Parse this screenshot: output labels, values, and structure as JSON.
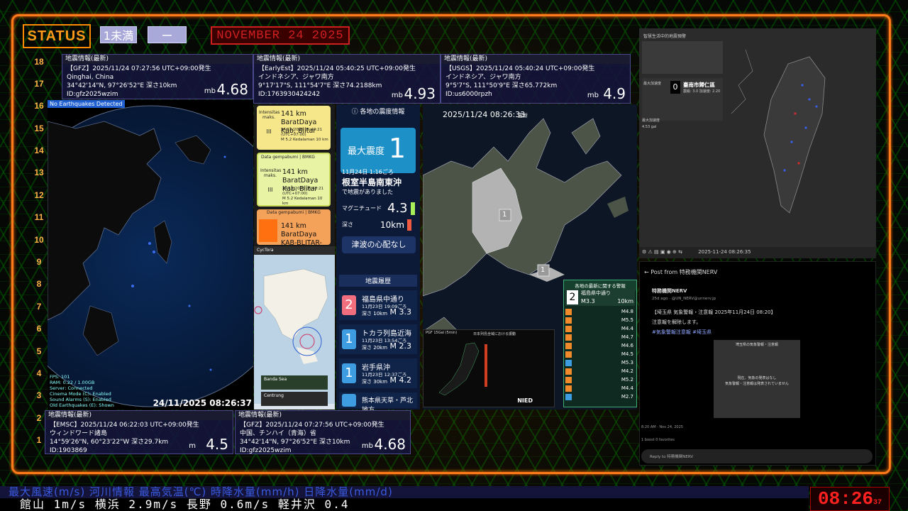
{
  "header": {
    "status_label": "STATUS",
    "chip1": "1未満",
    "chip2": "ー",
    "date": "NOVEMBER 24 2025"
  },
  "scale_numbers": [
    "18",
    "17",
    "16",
    "15",
    "14",
    "13",
    "12",
    "11",
    "10",
    "9",
    "8",
    "7",
    "6",
    "5",
    "4",
    "3",
    "2",
    "1"
  ],
  "cards": {
    "gfz_top": {
      "title": "地震情報(最新)",
      "line1": "【GFZ】2025/11/24  07:27:56  UTC+09:00発生",
      "line2": "Qinghai, China",
      "line3": "34°42'14\"N,  97°26'52\"E   深さ10km",
      "line4": "ID:gfz2025wzim",
      "unit": "mb",
      "mag": "4.68"
    },
    "earlyest": {
      "title": "地震情報(最新)",
      "line1": "【EarlyEst】2025/11/24  05:40:25  UTC+09:00発生",
      "line2": "インドネシア、ジャワ南方",
      "line3": "9°17'17\"S,  111°54'7\"E   深さ74.2188km",
      "line4": "ID:1763930424242",
      "unit": "mb",
      "mag": "4.93"
    },
    "usgs": {
      "title": "地震情報(最新)",
      "line1": "【USGS】2025/11/24  05:40:24  UTC+09:00発生",
      "line2": "インドネシア、ジャワ南方",
      "line3": "9°5'7\"S,  111°50'9\"E   深さ65.772km",
      "line4": "ID:us6000rpzh",
      "unit": "mb",
      "mag": "4.9"
    },
    "emsc": {
      "title": "地震情報(最新)",
      "line1": "【EMSC】2025/11/24  06:22:03  UTC+09:00発生",
      "line2": "ウィンドワード諸島",
      "line3": "14°59'26\"N,  60°23'22\"W   深さ29.7km",
      "line4": "ID:1903869",
      "unit": "m",
      "mag": "4.5"
    },
    "gfz_bottom": {
      "title": "地震情報(最新)",
      "line1": "【GFZ】2025/11/24  07:27:56  UTC+09:00発生",
      "line2": "中国、チンハイ（青海）省",
      "line3": "34°42'14\"N,  97°26'52\"E   深さ10km",
      "line4": "ID:gfz2025wzim",
      "unit": "mb",
      "mag": "4.68"
    }
  },
  "globe": {
    "notice": "No Earthquakes Detected",
    "timestamp": "24/11/2025 08:26:37",
    "debug": [
      "FPS: 101",
      "RAM: 0.22 / 1.00GB",
      "Server: Connected",
      "Cinema Mode (C): Enabled",
      "Sound Alarms (S): Enabled",
      "Old Earthquakes (E): Shown"
    ]
  },
  "bmkg": {
    "items": [
      {
        "header": "",
        "side": "Intensitas maks.",
        "roman": "III",
        "place": "141 km BaratDaya",
        "region": "Kab. Blitar",
        "meta": "24/11/2025 05:40:21 (UTC+07:00)",
        "meta2": "M 5.2   Kedalaman 10 km"
      },
      {
        "header": "Data gempabumi | BMKG",
        "side": "Intensitas maks.",
        "roman": "III",
        "place": "141 km BaratDaya",
        "region": "Kab. Blitar",
        "meta": "24/11/2025 05:40:21 (UTC+07:00)",
        "meta2": "M 5.2   Kedalaman 10 km"
      },
      {
        "header": "Data gempabumi | BMKG",
        "side": "",
        "roman": "",
        "place": "141 km BaratDaya",
        "region": "KAB-BLITAR-JATIM",
        "meta": "",
        "meta2": ""
      }
    ]
  },
  "cyclone": {
    "app": "CycTora",
    "card1": "Banda Sea",
    "card2": "Centrung"
  },
  "shindo": {
    "title": "ⓘ 各地の震度情報",
    "max_label": "最大震度",
    "max_value": "1",
    "time": "11月24日 1:16ごろ",
    "place": "根室半島南東沖",
    "note": "で地震がありました",
    "mag_label": "マグニチュード",
    "mag_value": "4.3",
    "depth_label": "深さ",
    "depth_value": "10km",
    "tsunami": "津波の心配なし",
    "history_title": "地震履歴",
    "history": [
      {
        "int": "2",
        "place": "福島県中通り",
        "date": "11月23日 19:09ごろ",
        "depth": "10km",
        "mag": "3.3",
        "color": "#f06e7e"
      },
      {
        "int": "1",
        "place": "トカラ列島近海",
        "date": "11月23日 13:54ごろ",
        "depth": "20km",
        "mag": "2.3",
        "color": "#3e9de0"
      },
      {
        "int": "1",
        "place": "岩手県沖",
        "date": "11月23日 12:37ごろ",
        "depth": "30km",
        "mag": "4.2",
        "color": "#3e9de0"
      },
      {
        "int": "",
        "place": "熊本県天草・芦北地方",
        "date": "",
        "depth": "",
        "mag": "",
        "color": "#3e9de0"
      }
    ],
    "depth_prefix": "深さ",
    "mag_prefix": "M"
  },
  "japan_map": {
    "time": "2025/11/24  08:26:33",
    "updated": "更新",
    "marker1": "1",
    "marker2": "1"
  },
  "warn_panel": {
    "title": "各地の最新に関する警報",
    "top_int": "2",
    "top_place": "福島県中通り",
    "top_mag": "M3.3",
    "top_depth": "10km",
    "mags": [
      "M4.8",
      "M5.5",
      "M4.4",
      "M4.7",
      "M4.6",
      "M4.5",
      "M5.3",
      "M4.2",
      "M5.2",
      "M4.4",
      "M2.7"
    ]
  },
  "nied": {
    "label1": "PGF 15Gal (5min)",
    "label2": "日本列島全域における振動",
    "brand": "NIED"
  },
  "taiwan": {
    "title": "智慧生活中的地震預警",
    "int": "0",
    "city": "臺南市歸仁區",
    "detail": "震級: 3.0   加速度: 2.20",
    "k1": "最大加速度",
    "k2": "最大加速度",
    "gal": "4.53 gal",
    "toolbar_time": "2025-11-24 08:26:35"
  },
  "post": {
    "header": "Post from 特務機関NERV",
    "account": "特務機関NERV",
    "handle": "25d ago · @UN_NERV@unnerv.jp",
    "line1": "【埼玉県 気象警報・注意報 2025年11月24日 08:20】",
    "line2": "注意報を解除します。",
    "tags": "#気象警報注意報 #埼玉県",
    "card_title": "埼玉県の気象警報・注意報",
    "card_text1": "現在、気象の発表はなし",
    "card_text2": "気象警報・注意報は発表されていません",
    "time": "8:20 AM · Nov 24, 2025",
    "stats": "1 boost   0 favorites",
    "reply": "Reply to 特務機関NERV"
  },
  "ticker": {
    "row1": "最大風速(m/s)  河川情報    最高気温(℃)    時降水量(mm/h)   日降水量(mm/d)",
    "row2": "館山 1m/s      横浜 2.9m/s      長野 0.6m/s      軽井沢 0.4"
  },
  "clock": {
    "time": "08:26",
    "sec": "37"
  }
}
